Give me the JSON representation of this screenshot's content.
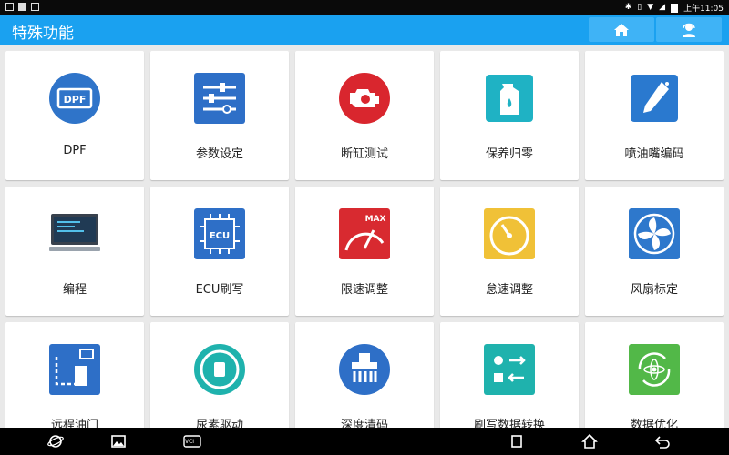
{
  "status_bar": {
    "time": "上午11:05"
  },
  "header": {
    "title": "特殊功能",
    "home_icon": "home-icon",
    "user_icon": "user-support-icon"
  },
  "colors": {
    "header": "#1aa1f0",
    "header_button": "#3fb3f6",
    "background": "#e9e9e9"
  },
  "tiles": [
    {
      "label": "DPF",
      "icon": "dpf-icon"
    },
    {
      "label": "参数设定",
      "icon": "sliders-icon"
    },
    {
      "label": "断缸测试",
      "icon": "engine-icon"
    },
    {
      "label": "保养归零",
      "icon": "oil-bottle-icon"
    },
    {
      "label": "喷油嘴编码",
      "icon": "injector-icon"
    },
    {
      "label": "编程",
      "icon": "monitor-icon"
    },
    {
      "label": "ECU刷写",
      "icon": "ecu-chip-icon"
    },
    {
      "label": "限速调整",
      "icon": "speed-limit-gauge-icon"
    },
    {
      "label": "怠速调整",
      "icon": "idle-gauge-icon"
    },
    {
      "label": "风扇标定",
      "icon": "fan-icon"
    },
    {
      "label": "远程油门",
      "icon": "remote-throttle-icon"
    },
    {
      "label": "尿素驱动",
      "icon": "urea-icon"
    },
    {
      "label": "深度清码",
      "icon": "brush-icon"
    },
    {
      "label": "刷写数据转换",
      "icon": "data-convert-icon"
    },
    {
      "label": "数据优化",
      "icon": "atom-refresh-icon"
    }
  ],
  "nav_bar": {
    "icons": [
      "browser-icon",
      "gallery-icon",
      "vci-icon",
      "back-icon-unused",
      "recents-icon",
      "home-nav-icon",
      "back-icon"
    ],
    "vci_label": "VCI"
  }
}
